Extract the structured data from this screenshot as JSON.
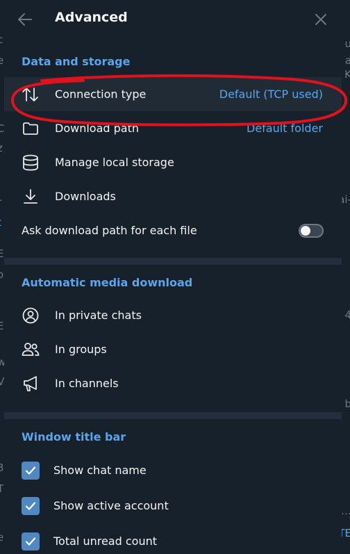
{
  "window": {
    "title": "Advanced"
  },
  "background_glyphs": {
    "left": [
      "c",
      "e",
      "|",
      "C",
      "z",
      "r",
      "t",
      "E",
      "o",
      "l",
      "E",
      "w",
      "V",
      "3",
      "T",
      "e"
    ],
    "right": [
      "u",
      "a",
      "K",
      "ai-",
      "4",
      "b",
      "…",
      "TE"
    ]
  },
  "sections": {
    "data_storage": {
      "title": "Data and storage",
      "items": {
        "connection_type": {
          "label": "Connection type",
          "value": "Default (TCP used)",
          "icon": "arrows-up-down-icon"
        },
        "download_path": {
          "label": "Download path",
          "value": "Default folder",
          "icon": "folder-icon"
        },
        "manage_storage": {
          "label": "Manage local storage",
          "icon": "database-icon"
        },
        "downloads": {
          "label": "Downloads",
          "icon": "download-icon"
        },
        "ask_path": {
          "label": "Ask download path for each file",
          "enabled": false
        }
      }
    },
    "auto_media": {
      "title": "Automatic media download",
      "items": {
        "private": {
          "label": "In private chats",
          "icon": "user-circle-icon"
        },
        "groups": {
          "label": "In groups",
          "icon": "users-icon"
        },
        "channels": {
          "label": "In channels",
          "icon": "megaphone-icon"
        }
      }
    },
    "title_bar": {
      "title": "Window title bar",
      "items": {
        "chat_name": {
          "label": "Show chat name",
          "checked": true
        },
        "active_account": {
          "label": "Show active account",
          "checked": true
        },
        "unread_count": {
          "label": "Total unread count",
          "checked": true
        }
      }
    }
  },
  "colors": {
    "accent": "#5aa5ec",
    "panel": "#17212b",
    "checkbox": "#5288c1",
    "annotation": "#e3101e"
  }
}
